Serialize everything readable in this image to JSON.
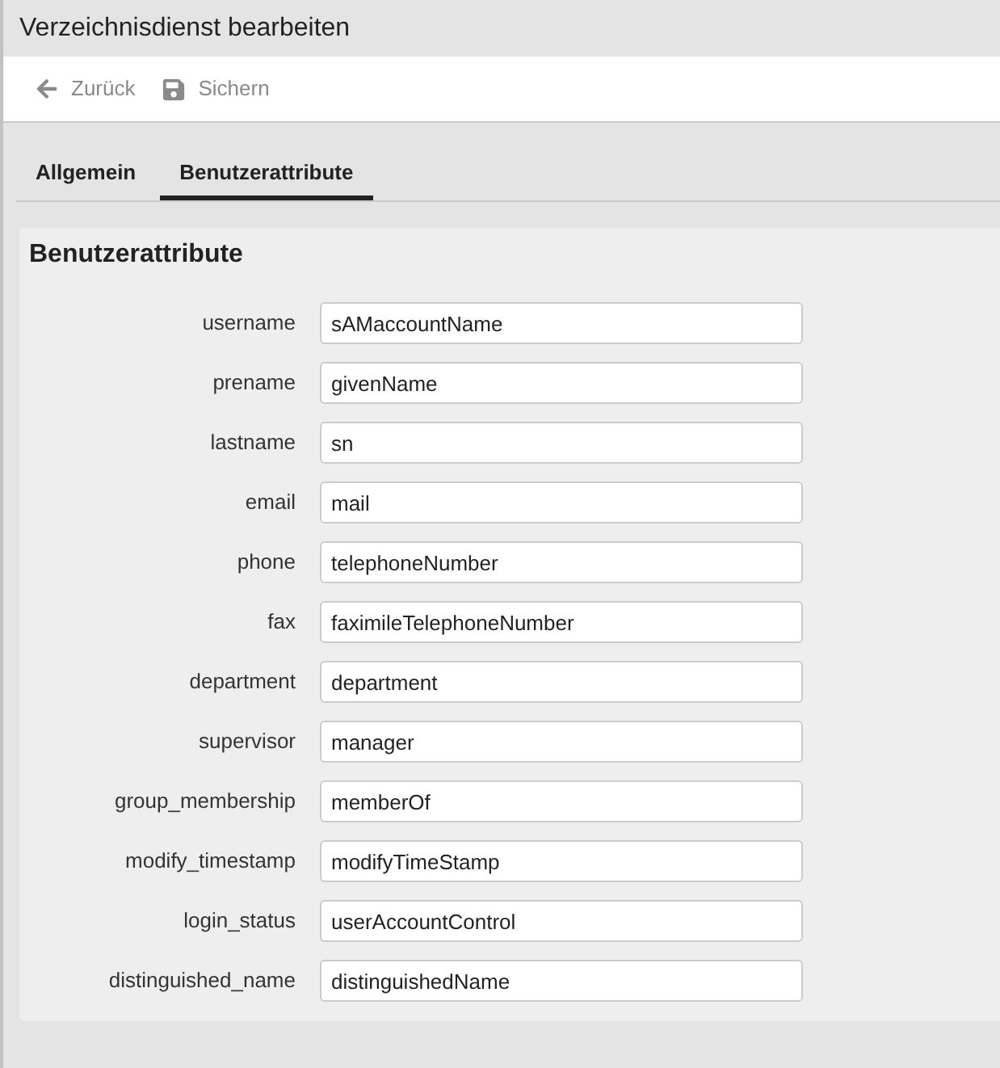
{
  "window": {
    "title": "Verzeichnisdienst bearbeiten"
  },
  "toolbar": [
    {
      "kind": "back",
      "label": "Zurück"
    },
    {
      "kind": "save",
      "label": "Sichern"
    }
  ],
  "tabs": [
    {
      "label": "Allgemein",
      "selected": false
    },
    {
      "label": "Benutzerattribute",
      "selected": true
    }
  ],
  "panel": {
    "title": "Benutzerattribute",
    "fields": [
      {
        "label": "username",
        "value": "sAMaccountName"
      },
      {
        "label": "prename",
        "value": "givenName"
      },
      {
        "label": "lastname",
        "value": "sn"
      },
      {
        "label": "email",
        "value": "mail"
      },
      {
        "label": "phone",
        "value": "telephoneNumber"
      },
      {
        "label": "fax",
        "value": "faximileTelephoneNumber"
      },
      {
        "label": "department",
        "value": "department"
      },
      {
        "label": "supervisor",
        "value": "manager"
      },
      {
        "label": "group_membership",
        "value": "memberOf"
      },
      {
        "label": "modify_timestamp",
        "value": "modifyTimeStamp"
      },
      {
        "label": "login_status",
        "value": "userAccountControl"
      },
      {
        "label": "distinguished_name",
        "value": "distinguishedName"
      }
    ]
  }
}
